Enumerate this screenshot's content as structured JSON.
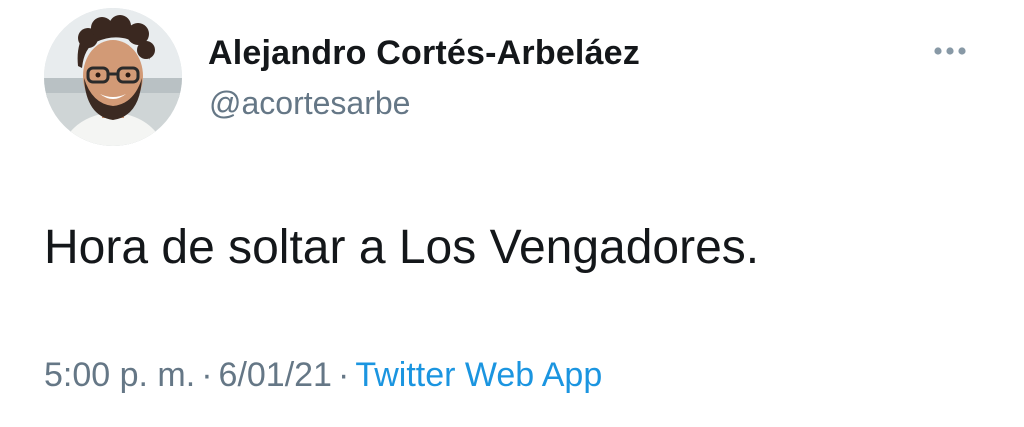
{
  "tweet": {
    "author": {
      "display_name": "Alejandro Cortés-Arbeláez",
      "handle": "@acortesarbe",
      "avatar_icon": "profile-photo"
    },
    "more_icon": "more-horizontal-icon",
    "text": "Hora de soltar a Los Vengadores.",
    "time": "5:00 p. m.",
    "separator": "·",
    "date": "6/01/21",
    "source": "Twitter Web App"
  },
  "colors": {
    "text_primary": "#14171a",
    "text_secondary": "#657786",
    "link": "#1b95e0",
    "background": "#ffffff"
  }
}
